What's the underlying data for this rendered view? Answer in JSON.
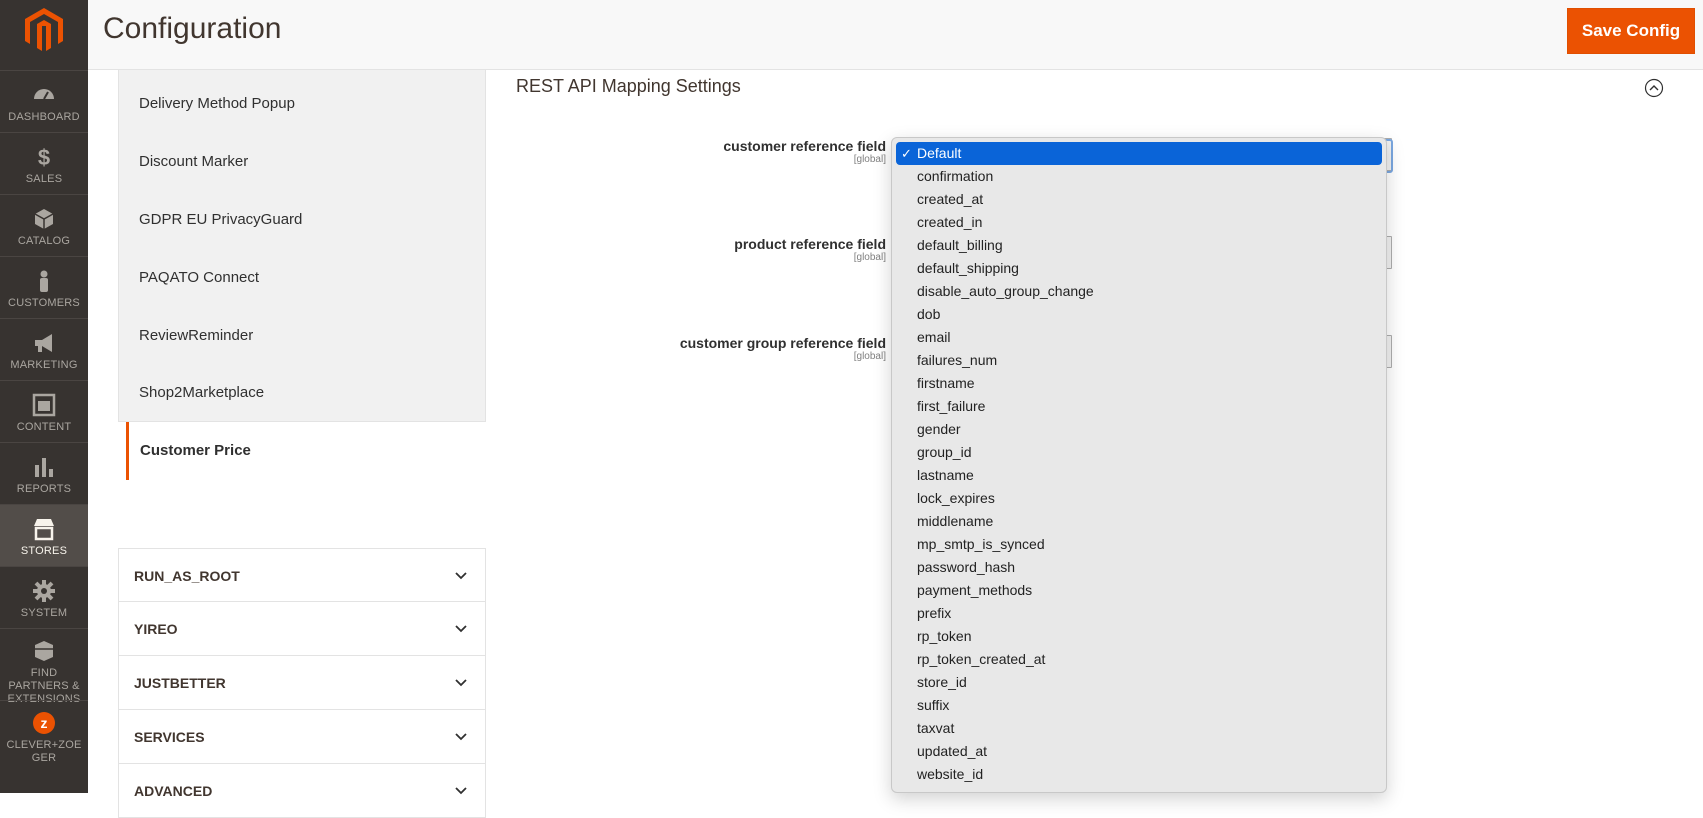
{
  "brand": {
    "accent": "#eb5202",
    "nav_bg": "#373330",
    "selection": "#0a64d8"
  },
  "admin_nav": [
    {
      "label": "DASHBOARD",
      "icon": "dashboard-icon"
    },
    {
      "label": "SALES",
      "icon": "dollar-icon"
    },
    {
      "label": "CATALOG",
      "icon": "cube-icon"
    },
    {
      "label": "CUSTOMERS",
      "icon": "person-icon"
    },
    {
      "label": "MARKETING",
      "icon": "megaphone-icon"
    },
    {
      "label": "CONTENT",
      "icon": "content-icon"
    },
    {
      "label": "REPORTS",
      "icon": "bar-chart-icon"
    },
    {
      "label": "STORES",
      "icon": "store-icon",
      "active": true
    },
    {
      "label": "SYSTEM",
      "icon": "gear-icon"
    },
    {
      "label": "FIND PARTNERS & EXTENSIONS",
      "icon": "box-icon"
    },
    {
      "label": "CLEVER+ZOEGER",
      "icon": "clever-zoeger-icon"
    }
  ],
  "header": {
    "title": "Configuration",
    "save_label": "Save Config"
  },
  "config_nav": {
    "sub_items": [
      "Delivery Method Popup",
      "Discount Marker",
      "GDPR EU PrivacyGuard",
      "PAQATO Connect",
      "ReviewReminder",
      "Shop2Marketplace"
    ],
    "active_item": "Customer Price",
    "sections": [
      "RUN_AS_ROOT",
      "YIREO",
      "JUSTBETTER",
      "SERVICES",
      "ADVANCED"
    ]
  },
  "fieldset": {
    "title": "REST API Mapping Settings",
    "fields": [
      {
        "name": "customer reference field",
        "scope": "[global]"
      },
      {
        "name": "product reference field",
        "scope": "[global]"
      },
      {
        "name": "customer group reference field",
        "scope": "[global]"
      }
    ]
  },
  "dropdown": {
    "selected": "Default",
    "options": [
      "Default",
      "confirmation",
      "created_at",
      "created_in",
      "default_billing",
      "default_shipping",
      "disable_auto_group_change",
      "dob",
      "email",
      "failures_num",
      "firstname",
      "first_failure",
      "gender",
      "group_id",
      "lastname",
      "lock_expires",
      "middlename",
      "mp_smtp_is_synced",
      "password_hash",
      "payment_methods",
      "prefix",
      "rp_token",
      "rp_token_created_at",
      "store_id",
      "suffix",
      "taxvat",
      "updated_at",
      "website_id"
    ]
  }
}
